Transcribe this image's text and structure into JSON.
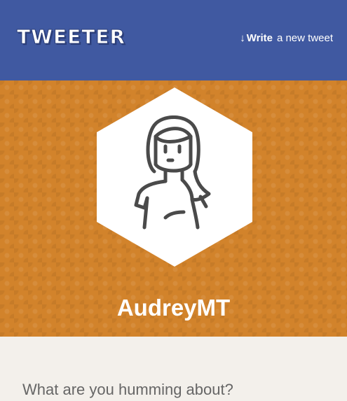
{
  "nav": {
    "logo_text": "TWEETER",
    "write_arrow": "🡓",
    "write_bold": "Write",
    "write_rest": "a new tweet"
  },
  "profile": {
    "username": "AudreyMT",
    "avatar_icon": "woman-avatar-icon"
  },
  "composer": {
    "placeholder": "What are you humming about?"
  },
  "colors": {
    "nav_bg": "#4059a1",
    "banner_bg": "#d2832b",
    "page_bg": "#f3f0eb"
  }
}
